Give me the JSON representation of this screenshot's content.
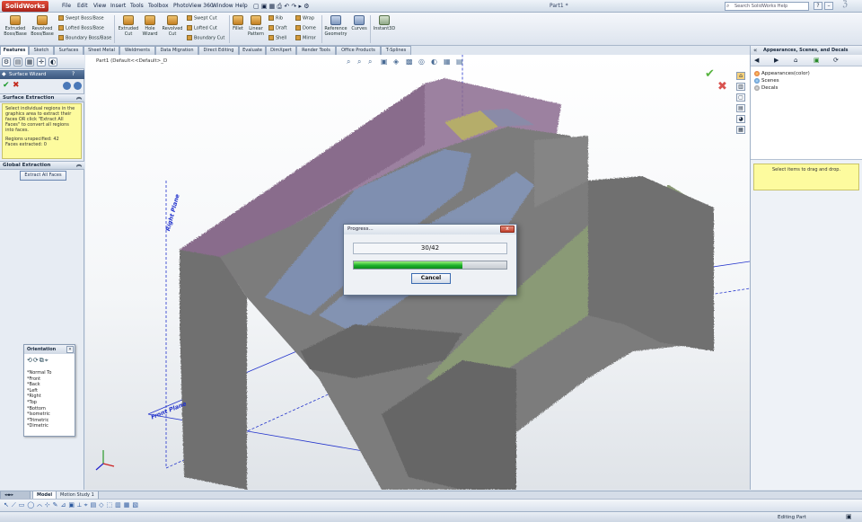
{
  "app": {
    "logo": "SolidWorks",
    "document_title": "Part1 *",
    "menu": [
      "File",
      "Edit",
      "View",
      "Insert",
      "Tools",
      "Toolbox",
      "PhotoView 360",
      "Window",
      "Help"
    ],
    "help_search_placeholder": "Search SolidWorks Help"
  },
  "command_manager": {
    "large": [
      {
        "label": "Extruded Boss/Base"
      },
      {
        "label": "Revolved Boss/Base"
      },
      {
        "label": "Extruded Cut"
      },
      {
        "label": "Hole Wizard"
      },
      {
        "label": "Revolved Cut"
      },
      {
        "label": "Fillet"
      },
      {
        "label": "Linear Pattern"
      },
      {
        "label": "Reference Geometry"
      },
      {
        "label": "Curves"
      },
      {
        "label": "Instant3D"
      }
    ],
    "small": [
      {
        "label": "Swept Boss/Base"
      },
      {
        "label": "Lofted Boss/Base"
      },
      {
        "label": "Boundary Boss/Base"
      },
      {
        "label": "Swept Cut"
      },
      {
        "label": "Lofted Cut"
      },
      {
        "label": "Boundary Cut"
      },
      {
        "label": "Rib"
      },
      {
        "label": "Draft"
      },
      {
        "label": "Shell"
      },
      {
        "label": "Wrap"
      },
      {
        "label": "Dome"
      },
      {
        "label": "Mirror"
      }
    ]
  },
  "tabs": [
    "Features",
    "Sketch",
    "Surfaces",
    "Sheet Metal",
    "Weldments",
    "Data Migration",
    "Direct Editing",
    "Evaluate",
    "DimXpert",
    "Render Tools",
    "Office Products",
    "T-Splines"
  ],
  "property_manager": {
    "wizard_title": "Surface Wizard",
    "surface_extraction": {
      "header": "Surface Extraction",
      "message": "Select individual regions in the graphics area to extract their faces OR click \"Extract All Faces\" to convert all regions into faces.",
      "regions_line": "Regions unspecified: 42",
      "faces_line": "Faces extracted: 0"
    },
    "global_extraction": {
      "header": "Global Extraction",
      "button": "Extract All Faces"
    }
  },
  "viewport": {
    "part_label": "Part1 (Default<<Default>_D",
    "right_plane_label": "Right Plane",
    "front_plane_label": "Front Plane"
  },
  "orientation": {
    "title": "Orientation",
    "views": [
      "*Normal To",
      "*Front",
      "*Back",
      "*Left",
      "*Right",
      "*Top",
      "*Bottom",
      "*Isometric",
      "*Trimetric",
      "*Dimetric"
    ]
  },
  "progress": {
    "title": "Progress...",
    "counter": "30/42",
    "fraction": 0.714,
    "cancel_label": "Cancel",
    "fill_color": "#1cb12b"
  },
  "task_pane": {
    "title": "Appearances, Scenes, and Decals",
    "tree": [
      "Appearances(color)",
      "Scenes",
      "Decals"
    ],
    "tip": "Select items to drag and drop."
  },
  "bottom_tabs": [
    "Model",
    "Motion Study 1"
  ],
  "status": {
    "text": "Editing Part"
  },
  "colors": {
    "accent": "#3a577e",
    "tooltip": "#fdfb9e",
    "plane": "#2233cc"
  }
}
